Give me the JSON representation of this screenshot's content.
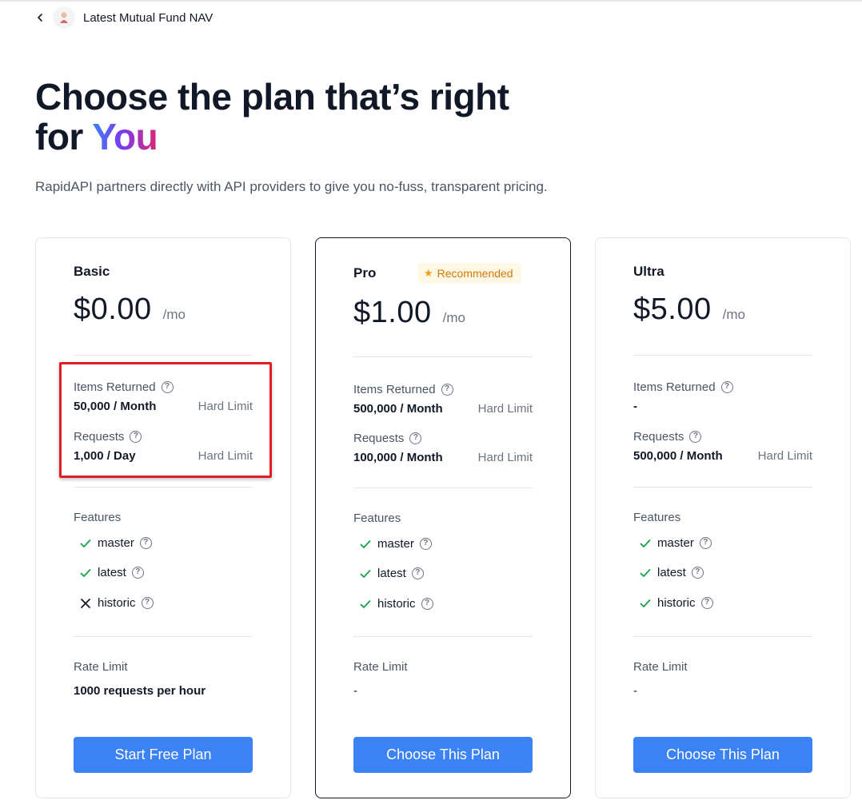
{
  "header": {
    "title": "Latest Mutual Fund NAV"
  },
  "hero": {
    "headline_line1": "Choose the plan that’s right",
    "headline_for": "for ",
    "headline_you": "You",
    "subtitle": "RapidAPI partners directly with API providers to give you no-fuss, transparent pricing."
  },
  "plans": [
    {
      "name": "Basic",
      "price": "$0.00",
      "per": "/mo",
      "metrics": [
        {
          "label": "Items Returned",
          "value": "50,000 / Month",
          "limit": "Hard Limit"
        },
        {
          "label": "Requests",
          "value": "1,000 / Day",
          "limit": "Hard Limit"
        }
      ],
      "features_title": "Features",
      "features": [
        {
          "name": "master",
          "included": true
        },
        {
          "name": "latest",
          "included": true
        },
        {
          "name": "historic",
          "included": false
        }
      ],
      "rate_limit_title": "Rate Limit",
      "rate_limit_value": "1000 requests per hour",
      "cta": "Start Free Plan"
    },
    {
      "name": "Pro",
      "badge": "Recommended",
      "price": "$1.00",
      "per": "/mo",
      "metrics": [
        {
          "label": "Items Returned",
          "value": "500,000 / Month",
          "limit": "Hard Limit"
        },
        {
          "label": "Requests",
          "value": "100,000 / Month",
          "limit": "Hard Limit"
        }
      ],
      "features_title": "Features",
      "features": [
        {
          "name": "master",
          "included": true
        },
        {
          "name": "latest",
          "included": true
        },
        {
          "name": "historic",
          "included": true
        }
      ],
      "rate_limit_title": "Rate Limit",
      "rate_limit_value": "-",
      "cta": "Choose This Plan"
    },
    {
      "name": "Ultra",
      "price": "$5.00",
      "per": "/mo",
      "metrics": [
        {
          "label": "Items Returned",
          "value": "-",
          "limit": ""
        },
        {
          "label": "Requests",
          "value": "500,000 / Month",
          "limit": "Hard Limit"
        }
      ],
      "features_title": "Features",
      "features": [
        {
          "name": "master",
          "included": true
        },
        {
          "name": "latest",
          "included": true
        },
        {
          "name": "historic",
          "included": true
        }
      ],
      "rate_limit_title": "Rate Limit",
      "rate_limit_value": "-",
      "cta": "Choose This Plan"
    }
  ],
  "icons": {
    "back": "chevron-left-icon",
    "help": "question-circle-icon",
    "included": "check-icon",
    "excluded": "x-icon",
    "badge": "star-icon"
  },
  "colors": {
    "accent": "#3b82f6",
    "check": "#16a34a",
    "badge_text": "#d97706",
    "badge_bg": "#fef9e7",
    "highlight": "#e11d24"
  }
}
